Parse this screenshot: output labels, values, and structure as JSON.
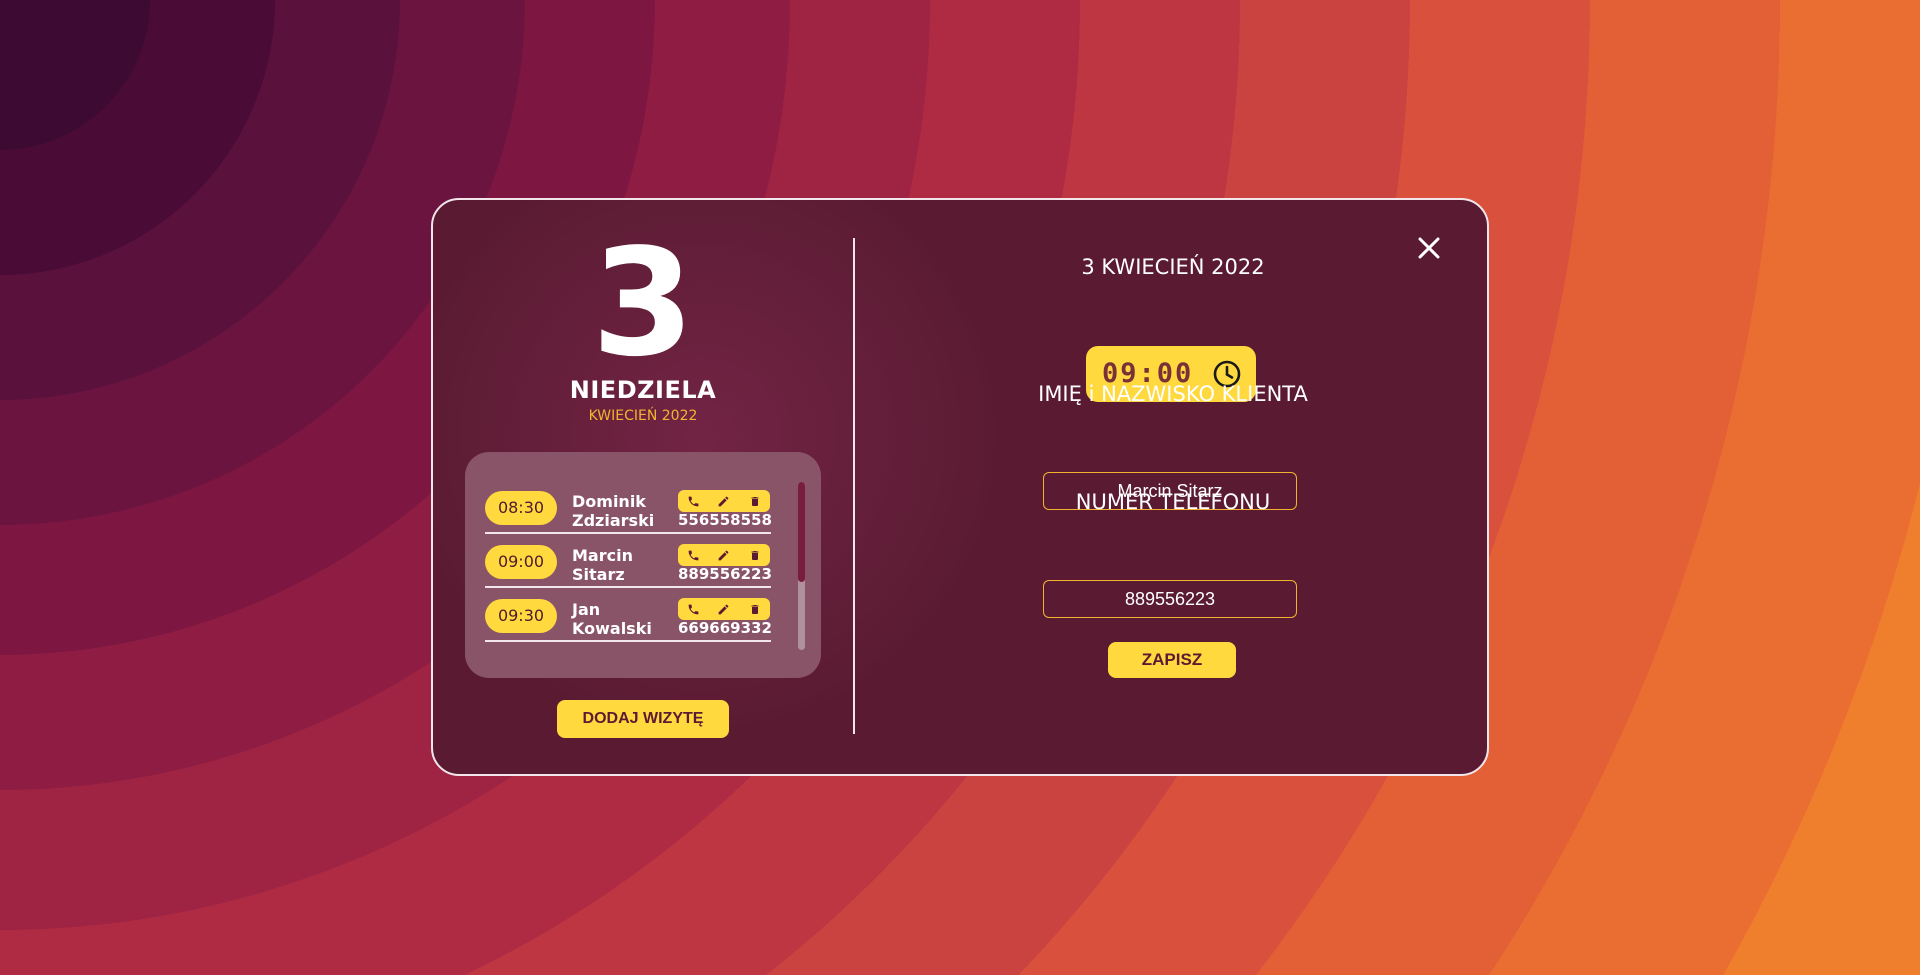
{
  "day_panel": {
    "day_number": "3",
    "day_name": "NIEDZIELA",
    "month_year": "KWIECIEŃ 2022"
  },
  "appointments": [
    {
      "time": "08:30",
      "first_name": "Dominik",
      "last_name": "Zdziarski",
      "phone": "556558558"
    },
    {
      "time": "09:00",
      "first_name": "Marcin",
      "last_name": "Sitarz",
      "phone": "889556223"
    },
    {
      "time": "09:30",
      "first_name": "Jan",
      "last_name": "Kowalski",
      "phone": "669669332"
    }
  ],
  "appointment_actions": [
    "phone-icon",
    "pencil-icon",
    "trash-icon"
  ],
  "add_button": "DODAJ WIZYTĘ",
  "form": {
    "date_title": "3 KWIECIEŃ 2022",
    "time_value": "09:00",
    "name_label": "IMIĘ i NAZWISKO KLIENTA",
    "name_value": "Marcin Sitarz",
    "phone_label": "NUMER TELEFONU",
    "phone_value": "889556223",
    "save_button": "ZAPISZ"
  },
  "icons": {
    "close": "close-icon",
    "time": "clock-icon"
  },
  "colors": {
    "accent": "#ffd93d",
    "modal": "#5a1b32",
    "input_border": "#f2b430"
  }
}
